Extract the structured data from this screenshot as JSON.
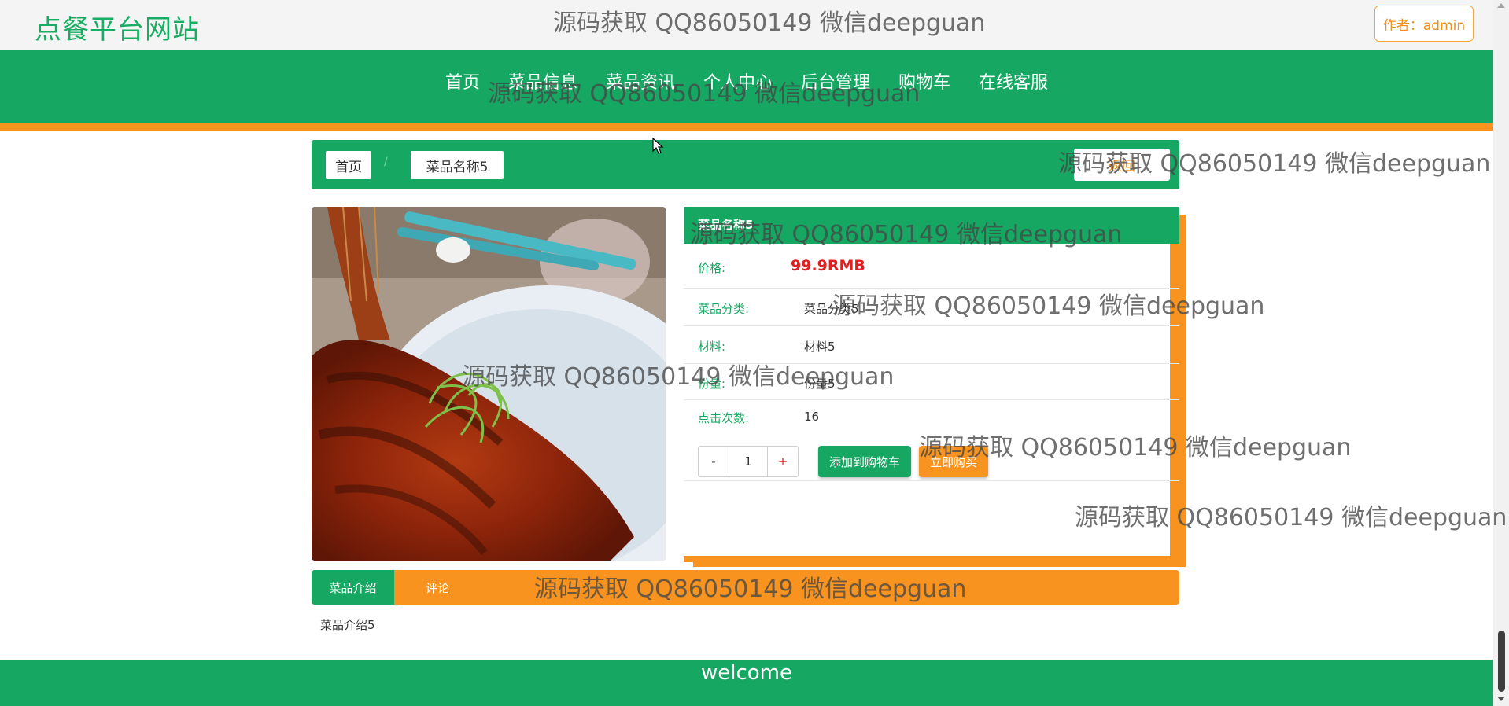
{
  "site": {
    "logo": "点餐平台网站",
    "author_label": "作者：admin"
  },
  "nav": {
    "items": [
      "首页",
      "菜品信息",
      "菜品资讯",
      "个人中心",
      "后台管理",
      "购物车",
      "在线客服"
    ]
  },
  "breadcrumb": {
    "home": "首页",
    "separator": "/",
    "current": "菜品名称5",
    "back_label": "返回"
  },
  "dish": {
    "title": "菜品名称5",
    "price_label": "价格:",
    "price_value": "99.9RMB",
    "category_label": "菜品分类:",
    "category_value": "菜品分类5",
    "material_label": "材料:",
    "material_value": "材料5",
    "portion_label": "份量:",
    "portion_value": "份量5",
    "clicks_label": "点击次数:",
    "clicks_value": "16",
    "quantity": "1",
    "minus": "-",
    "plus": "+",
    "add_to_cart": "添加到购物车",
    "buy_now": "立即购买"
  },
  "tabs": {
    "intro": "菜品介绍",
    "comment": "评论"
  },
  "intro_text": "菜品介绍5",
  "footer": {
    "text": "welcome"
  },
  "watermark": "源码获取 QQ86050149 微信deepguan",
  "colors": {
    "primary_green": "#16a862",
    "accent_orange": "#f7931e",
    "price_red": "#e02020"
  }
}
